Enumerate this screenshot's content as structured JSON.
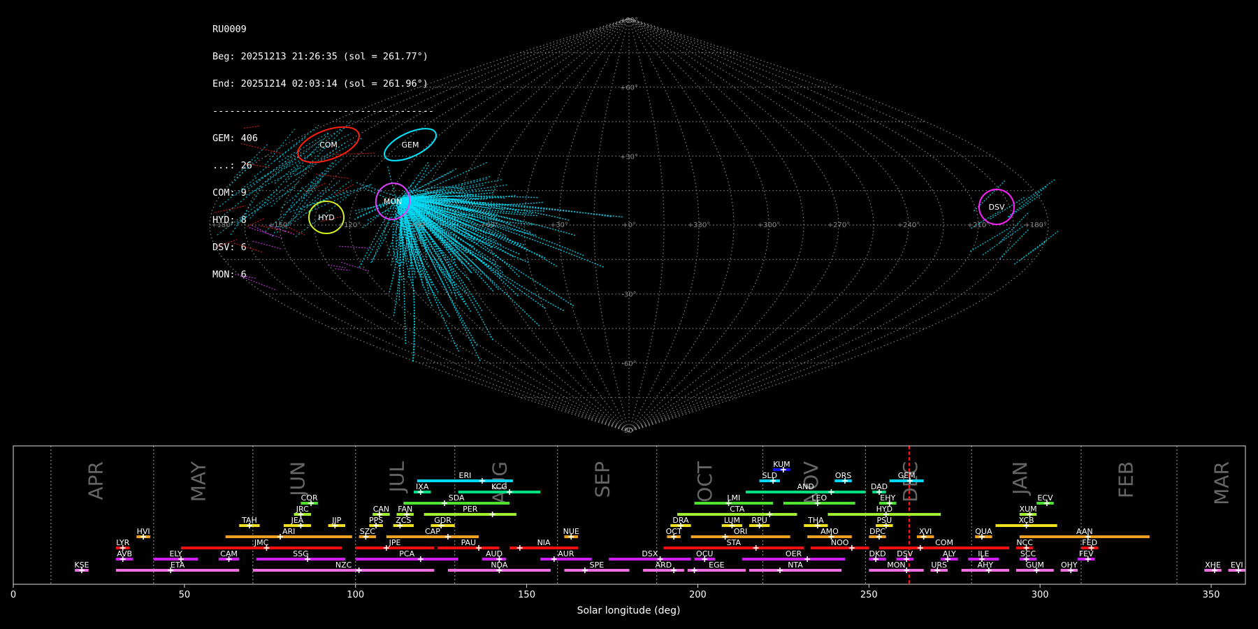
{
  "header": {
    "station": "RU0009",
    "beg": "Beg: 20251213 21:26:35 (sol = 261.77°)",
    "end": "End: 20251214 02:03:14 (sol = 261.96°)",
    "separator": "---------------------------------------",
    "counts": [
      "GEM: 406",
      "...: 26",
      "COM: 9",
      "HYD: 8",
      "DSV: 6",
      "MON: 6"
    ]
  },
  "sky_map": {
    "projection": "sinusoidal",
    "lat_labels": [
      "+90°",
      "+60°",
      "+30°",
      "-30°",
      "-60°",
      "-90°"
    ],
    "lon_labels": [
      "+180°",
      "+150°",
      "+120°",
      "+90°",
      "+60°",
      "+30°",
      "+0°",
      "+330°",
      "+300°",
      "+270°",
      "+240°",
      "+210°",
      "+180°"
    ],
    "radiants": [
      {
        "code": "COM",
        "lon": 135,
        "lat": 12,
        "color": "#ff2010"
      },
      {
        "code": "GEM",
        "lon": 100,
        "lat": 12,
        "color": "#00e5ff"
      },
      {
        "code": "HYD",
        "lon": 135,
        "lat": -2,
        "color": "#d8f020"
      },
      {
        "code": "MON",
        "lon": 105,
        "lat": 3,
        "color": "#e040ff"
      },
      {
        "code": "DSV",
        "lon": 222,
        "lat": 3,
        "color": "#ff20ff"
      }
    ],
    "colors": {
      "gem": "#00e5ff",
      "spor": "#ff2020",
      "other": "#e040ff",
      "grid": "#9a9a9a"
    }
  },
  "chart_data": {
    "type": "gantt",
    "xlabel": "Solar longitude (deg)",
    "xlim": [
      0,
      360
    ],
    "x_ticks": [
      0,
      50,
      100,
      150,
      200,
      250,
      300,
      350
    ],
    "months": [
      {
        "name": "APR",
        "x": 24
      },
      {
        "name": "MAY",
        "x": 54
      },
      {
        "name": "JUN",
        "x": 83
      },
      {
        "name": "JUL",
        "x": 112
      },
      {
        "name": "AUG",
        "x": 142
      },
      {
        "name": "SEP",
        "x": 172
      },
      {
        "name": "OCT",
        "x": 202
      },
      {
        "name": "NOV",
        "x": 233
      },
      {
        "name": "DEC",
        "x": 262
      },
      {
        "name": "JAN",
        "x": 294
      },
      {
        "name": "FEB",
        "x": 325
      },
      {
        "name": "MAR",
        "x": 353
      }
    ],
    "month_dividers": [
      11,
      41,
      70,
      100,
      129,
      159,
      188,
      219,
      249,
      280,
      312,
      340
    ],
    "current_sol": 261.8,
    "showers": [
      {
        "code": "KUM",
        "start": 222,
        "end": 227,
        "peak": 225,
        "row": 10,
        "color": "#1010f0"
      },
      {
        "code": "ERI",
        "start": 118,
        "end": 146,
        "peak": 137,
        "row": 9,
        "color": "#00d8ff"
      },
      {
        "code": "SLD",
        "start": 218,
        "end": 224,
        "peak": 222,
        "row": 9,
        "color": "#00d8ff"
      },
      {
        "code": "ORS",
        "start": 240,
        "end": 245,
        "peak": 243,
        "row": 9,
        "color": "#00d8ff"
      },
      {
        "code": "GEM",
        "start": 256,
        "end": 266,
        "peak": 262,
        "row": 9,
        "color": "#00d8ff"
      },
      {
        "code": "IXA",
        "start": 117,
        "end": 122,
        "peak": 119,
        "row": 8,
        "color": "#00e080"
      },
      {
        "code": "KCG",
        "start": 130,
        "end": 154,
        "peak": 145,
        "row": 8,
        "color": "#00e080"
      },
      {
        "code": "AND",
        "start": 214,
        "end": 249,
        "peak": 239,
        "row": 8,
        "color": "#00e080"
      },
      {
        "code": "DAD",
        "start": 251,
        "end": 255,
        "peak": 253,
        "row": 8,
        "color": "#00e080"
      },
      {
        "code": "COR",
        "start": 84,
        "end": 89,
        "peak": 87,
        "row": 7,
        "color": "#50e030"
      },
      {
        "code": "SDA",
        "start": 114,
        "end": 145,
        "peak": 126,
        "row": 7,
        "color": "#50e030"
      },
      {
        "code": "LMI",
        "start": 199,
        "end": 222,
        "peak": 209,
        "row": 7,
        "color": "#50e030"
      },
      {
        "code": "LEO",
        "start": 225,
        "end": 246,
        "peak": 235,
        "row": 7,
        "color": "#50e030"
      },
      {
        "code": "EHY",
        "start": 253,
        "end": 258,
        "peak": 256,
        "row": 7,
        "color": "#50e030"
      },
      {
        "code": "ECV",
        "start": 299,
        "end": 304,
        "peak": 302,
        "row": 7,
        "color": "#50e030"
      },
      {
        "code": "JRC",
        "start": 82,
        "end": 87,
        "peak": 84,
        "row": 6,
        "color": "#a0f030"
      },
      {
        "code": "CAN",
        "start": 105,
        "end": 110,
        "peak": 107,
        "row": 6,
        "color": "#a0f030"
      },
      {
        "code": "FAN",
        "start": 112,
        "end": 117,
        "peak": 115,
        "row": 6,
        "color": "#a0f030"
      },
      {
        "code": "PER",
        "start": 120,
        "end": 147,
        "peak": 140,
        "row": 6,
        "color": "#a0f030"
      },
      {
        "code": "CTA",
        "start": 194,
        "end": 229,
        "peak": 221,
        "row": 6,
        "color": "#a0f030"
      },
      {
        "code": "HYD",
        "start": 238,
        "end": 271,
        "peak": 255,
        "row": 6,
        "color": "#a0f030"
      },
      {
        "code": "XUM",
        "start": 294,
        "end": 299,
        "peak": 297,
        "row": 6,
        "color": "#a0f030"
      },
      {
        "code": "TAH",
        "start": 66,
        "end": 72,
        "peak": 69,
        "row": 5,
        "color": "#f0e020"
      },
      {
        "code": "JEA",
        "start": 79,
        "end": 87,
        "peak": 84,
        "row": 5,
        "color": "#f0e020"
      },
      {
        "code": "JIP",
        "start": 92,
        "end": 97,
        "peak": 94,
        "row": 5,
        "color": "#f0e020"
      },
      {
        "code": "PPS",
        "start": 104,
        "end": 108,
        "peak": 106,
        "row": 5,
        "color": "#f0e020"
      },
      {
        "code": "ZCS",
        "start": 111,
        "end": 117,
        "peak": 113,
        "row": 5,
        "color": "#f0e020"
      },
      {
        "code": "GDR",
        "start": 122,
        "end": 129,
        "peak": 125,
        "row": 5,
        "color": "#f0e020"
      },
      {
        "code": "DRA",
        "start": 192,
        "end": 198,
        "peak": 195,
        "row": 5,
        "color": "#f0e020"
      },
      {
        "code": "LUM",
        "start": 207,
        "end": 213,
        "peak": 210,
        "row": 5,
        "color": "#f0e020"
      },
      {
        "code": "RPU",
        "start": 215,
        "end": 221,
        "peak": 218,
        "row": 5,
        "color": "#f0e020"
      },
      {
        "code": "THA",
        "start": 231,
        "end": 238,
        "peak": 235,
        "row": 5,
        "color": "#f0e020"
      },
      {
        "code": "PSU",
        "start": 252,
        "end": 257,
        "peak": 255,
        "row": 5,
        "color": "#f0e020"
      },
      {
        "code": "XCB",
        "start": 287,
        "end": 305,
        "peak": 296,
        "row": 5,
        "color": "#f0e020"
      },
      {
        "code": "HVI",
        "start": 36,
        "end": 40,
        "peak": 38,
        "row": 4,
        "color": "#f0a020"
      },
      {
        "code": "ARI",
        "start": 62,
        "end": 99,
        "peak": 78,
        "row": 4,
        "color": "#f0a020"
      },
      {
        "code": "SZC",
        "start": 101,
        "end": 106,
        "peak": 103,
        "row": 4,
        "color": "#f0a020"
      },
      {
        "code": "CAP",
        "start": 109,
        "end": 136,
        "peak": 127,
        "row": 4,
        "color": "#f0a020"
      },
      {
        "code": "NUE",
        "start": 161,
        "end": 165,
        "peak": 163,
        "row": 4,
        "color": "#f0a020"
      },
      {
        "code": "OCT",
        "start": 191,
        "end": 195,
        "peak": 193,
        "row": 4,
        "color": "#f0a020"
      },
      {
        "code": "ORI",
        "start": 198,
        "end": 227,
        "peak": 208,
        "row": 4,
        "color": "#f0a020"
      },
      {
        "code": "AMO",
        "start": 232,
        "end": 245,
        "peak": 239,
        "row": 4,
        "color": "#f0a020"
      },
      {
        "code": "DPC",
        "start": 250,
        "end": 255,
        "peak": 253,
        "row": 4,
        "color": "#f0a020"
      },
      {
        "code": "XVI",
        "start": 264,
        "end": 269,
        "peak": 266,
        "row": 4,
        "color": "#f0a020"
      },
      {
        "code": "QUA",
        "start": 281,
        "end": 286,
        "peak": 283,
        "row": 4,
        "color": "#f0a020"
      },
      {
        "code": "AAN",
        "start": 294,
        "end": 332,
        "peak": 314,
        "row": 4,
        "color": "#f0a020"
      },
      {
        "code": "LYR",
        "start": 30,
        "end": 34,
        "peak": 32,
        "row": 3,
        "color": "#f01010"
      },
      {
        "code": "JMC",
        "start": 49,
        "end": 96,
        "peak": 74,
        "row": 3,
        "color": "#f01010"
      },
      {
        "code": "JPE",
        "start": 100,
        "end": 123,
        "peak": 109,
        "row": 3,
        "color": "#f01010"
      },
      {
        "code": "PAU",
        "start": 124,
        "end": 142,
        "peak": 136,
        "row": 3,
        "color": "#f01010"
      },
      {
        "code": "NIA",
        "start": 145,
        "end": 165,
        "peak": 148,
        "row": 3,
        "color": "#f01010"
      },
      {
        "code": "STA",
        "start": 190,
        "end": 231,
        "peak": 217,
        "row": 3,
        "color": "#f01010"
      },
      {
        "code": "NOO",
        "start": 233,
        "end": 250,
        "peak": 245,
        "row": 3,
        "color": "#f01010"
      },
      {
        "code": "COM",
        "start": 253,
        "end": 291,
        "peak": 265,
        "row": 3,
        "color": "#f01010"
      },
      {
        "code": "NCC",
        "start": 293,
        "end": 298,
        "peak": 296,
        "row": 3,
        "color": "#f01010"
      },
      {
        "code": "FED",
        "start": 312,
        "end": 317,
        "peak": 315,
        "row": 3,
        "color": "#f01010"
      },
      {
        "code": "AVB",
        "start": 30,
        "end": 35,
        "peak": 32,
        "row": 2,
        "color": "#d020f0"
      },
      {
        "code": "ELY",
        "start": 41,
        "end": 54,
        "peak": 49,
        "row": 2,
        "color": "#d020f0"
      },
      {
        "code": "CAM",
        "start": 60,
        "end": 66,
        "peak": 63,
        "row": 2,
        "color": "#d020f0"
      },
      {
        "code": "SSG",
        "start": 71,
        "end": 97,
        "peak": 86,
        "row": 2,
        "color": "#d020f0"
      },
      {
        "code": "PCA",
        "start": 100,
        "end": 130,
        "peak": 119,
        "row": 2,
        "color": "#d020f0"
      },
      {
        "code": "AUD",
        "start": 137,
        "end": 144,
        "peak": 142,
        "row": 2,
        "color": "#d020f0"
      },
      {
        "code": "AUR",
        "start": 154,
        "end": 169,
        "peak": 158,
        "row": 2,
        "color": "#d020f0"
      },
      {
        "code": "DSX",
        "start": 174,
        "end": 198,
        "peak": 189,
        "row": 2,
        "color": "#d020f0"
      },
      {
        "code": "OCU",
        "start": 199,
        "end": 205,
        "peak": 202,
        "row": 2,
        "color": "#d020f0"
      },
      {
        "code": "OER",
        "start": 213,
        "end": 243,
        "peak": 232,
        "row": 2,
        "color": "#d020f0"
      },
      {
        "code": "DKD",
        "start": 250,
        "end": 255,
        "peak": 252,
        "row": 2,
        "color": "#d020f0"
      },
      {
        "code": "DSV",
        "start": 258,
        "end": 263,
        "peak": 261,
        "row": 2,
        "color": "#d020f0"
      },
      {
        "code": "ALY",
        "start": 271,
        "end": 276,
        "peak": 273,
        "row": 2,
        "color": "#d020f0"
      },
      {
        "code": "ILE",
        "start": 279,
        "end": 288,
        "peak": 283,
        "row": 2,
        "color": "#d020f0"
      },
      {
        "code": "SCC",
        "start": 294,
        "end": 299,
        "peak": 296,
        "row": 2,
        "color": "#d020f0"
      },
      {
        "code": "FEV",
        "start": 311,
        "end": 316,
        "peak": 314,
        "row": 2,
        "color": "#d020f0"
      },
      {
        "code": "KSE",
        "start": 18,
        "end": 22,
        "peak": 20,
        "row": 1,
        "color": "#f070e0"
      },
      {
        "code": "ETA",
        "start": 30,
        "end": 66,
        "peak": 46,
        "row": 1,
        "color": "#f070e0"
      },
      {
        "code": "NZC",
        "start": 70,
        "end": 123,
        "peak": 101,
        "row": 1,
        "color": "#f070e0"
      },
      {
        "code": "NDA",
        "start": 127,
        "end": 157,
        "peak": 142,
        "row": 1,
        "color": "#f070e0"
      },
      {
        "code": "SPE",
        "start": 161,
        "end": 180,
        "peak": 167,
        "row": 1,
        "color": "#f070e0"
      },
      {
        "code": "ARD",
        "start": 184,
        "end": 196,
        "peak": 193,
        "row": 1,
        "color": "#f070e0"
      },
      {
        "code": "EGE",
        "start": 197,
        "end": 214,
        "peak": 199,
        "row": 1,
        "color": "#f070e0"
      },
      {
        "code": "NTA",
        "start": 215,
        "end": 242,
        "peak": 224,
        "row": 1,
        "color": "#f070e0"
      },
      {
        "code": "MON",
        "start": 250,
        "end": 266,
        "peak": 261,
        "row": 1,
        "color": "#f070e0"
      },
      {
        "code": "URS",
        "start": 268,
        "end": 273,
        "peak": 270,
        "row": 1,
        "color": "#f070e0"
      },
      {
        "code": "AHY",
        "start": 277,
        "end": 291,
        "peak": 285,
        "row": 1,
        "color": "#f070e0"
      },
      {
        "code": "GUM",
        "start": 293,
        "end": 304,
        "peak": 299,
        "row": 1,
        "color": "#f070e0"
      },
      {
        "code": "OHY",
        "start": 306,
        "end": 311,
        "peak": 309,
        "row": 1,
        "color": "#f070e0"
      },
      {
        "code": "XHE",
        "start": 348,
        "end": 353,
        "peak": 351,
        "row": 1,
        "color": "#f070e0"
      },
      {
        "code": "EVI",
        "start": 355,
        "end": 360,
        "peak": 358,
        "row": 1,
        "color": "#f070e0"
      }
    ]
  }
}
